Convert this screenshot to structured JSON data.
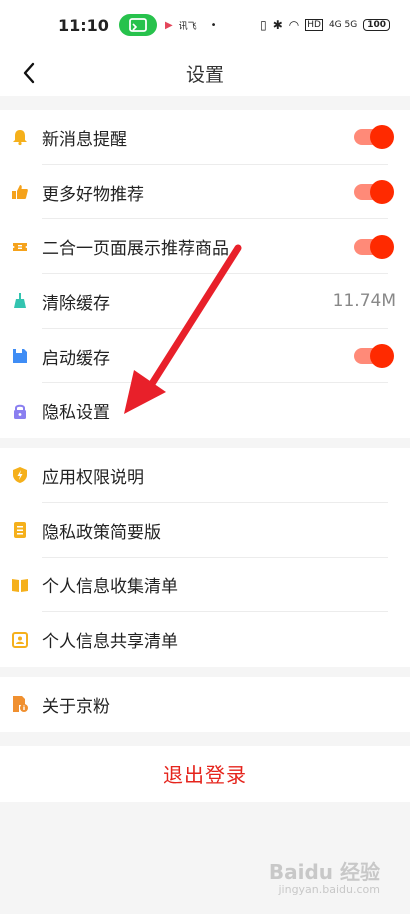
{
  "status_bar": {
    "time": "11:10",
    "app_label": "讯飞",
    "dot": "•",
    "network": "4G 5G",
    "battery": "100"
  },
  "header": {
    "title": "设置"
  },
  "groups": [
    {
      "items": [
        {
          "label": "新消息提醒",
          "icon": "bell-icon",
          "color": "#f5b01b",
          "toggle": true
        },
        {
          "label": "更多好物推荐",
          "icon": "thumbs-up-icon",
          "color": "#f5a21b",
          "toggle": true
        },
        {
          "label": "二合一页面展示推荐商品",
          "icon": "ticket-icon",
          "color": "#f5a21b",
          "toggle": true
        },
        {
          "label": "清除缓存",
          "icon": "broom-icon",
          "color": "#33c4b0",
          "value": "11.74M"
        },
        {
          "label": "启动缓存",
          "icon": "floppy-icon",
          "color": "#3f8df5",
          "toggle": true
        },
        {
          "label": "隐私设置",
          "icon": "lock-icon",
          "color": "#8a7ff0"
        }
      ]
    },
    {
      "items": [
        {
          "label": "应用权限说明",
          "icon": "shield-icon",
          "color": "#f5b01b"
        },
        {
          "label": "隐私政策简要版",
          "icon": "document-list-icon",
          "color": "#f5b01b"
        },
        {
          "label": "个人信息收集清单",
          "icon": "open-book-icon",
          "color": "#f5b01b"
        },
        {
          "label": "个人信息共享清单",
          "icon": "share-doc-icon",
          "color": "#f5b01b"
        }
      ]
    },
    {
      "items": [
        {
          "label": "关于京粉",
          "icon": "info-doc-icon",
          "color": "#f09030"
        }
      ]
    }
  ],
  "logout_label": "退出登录",
  "watermark": {
    "text": "Baidu 经验",
    "sub": "jingyan.baidu.com"
  },
  "colors": {
    "accent": "#e5241c",
    "toggle_on": "#ff2a00",
    "annotation_arrow": "#e8202a"
  }
}
